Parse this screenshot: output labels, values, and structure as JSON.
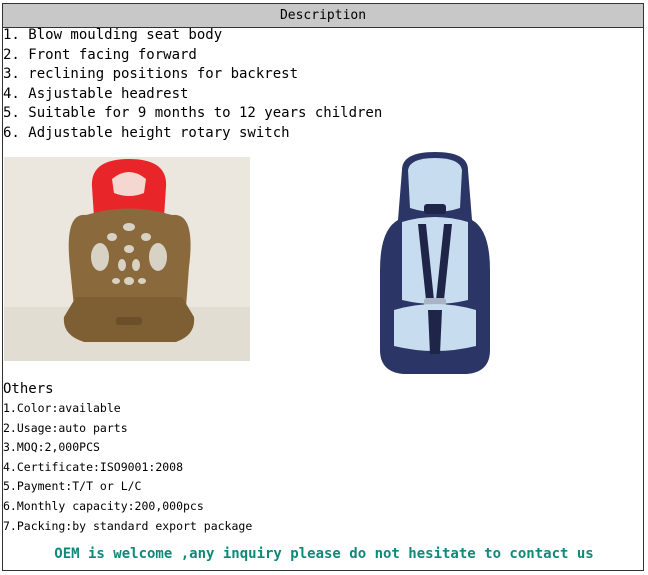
{
  "header": {
    "title": "Description"
  },
  "features": [
    "1. Blow moulding seat body",
    "2. Front facing forward",
    "3. reclining positions for backrest",
    "4. Asjustable headrest",
    "5. Suitable for 9 months to 12 years children",
    "6. Adjustable height rotary switch"
  ],
  "others": {
    "title": "Others",
    "items": [
      "1.Color:available",
      "2.Usage:auto parts",
      "3.MOQ:2,000PCS",
      "4.Certificate:ISO9001:2008",
      "5.Payment:T/T or L/C",
      "6.Monthly capacity:200,000pcs",
      "7.Packing:by standard export package"
    ]
  },
  "footer": {
    "text": "OEM is welcome ,any inquiry please do not hesitate to contact us"
  },
  "colors": {
    "footer_text": "#10887a",
    "header_bg": "#c8c8c8",
    "shell_red": "#e8262a",
    "shell_brown": "#8a6a3c",
    "seat_navy": "#2b3566",
    "seat_light": "#c7dcef"
  }
}
